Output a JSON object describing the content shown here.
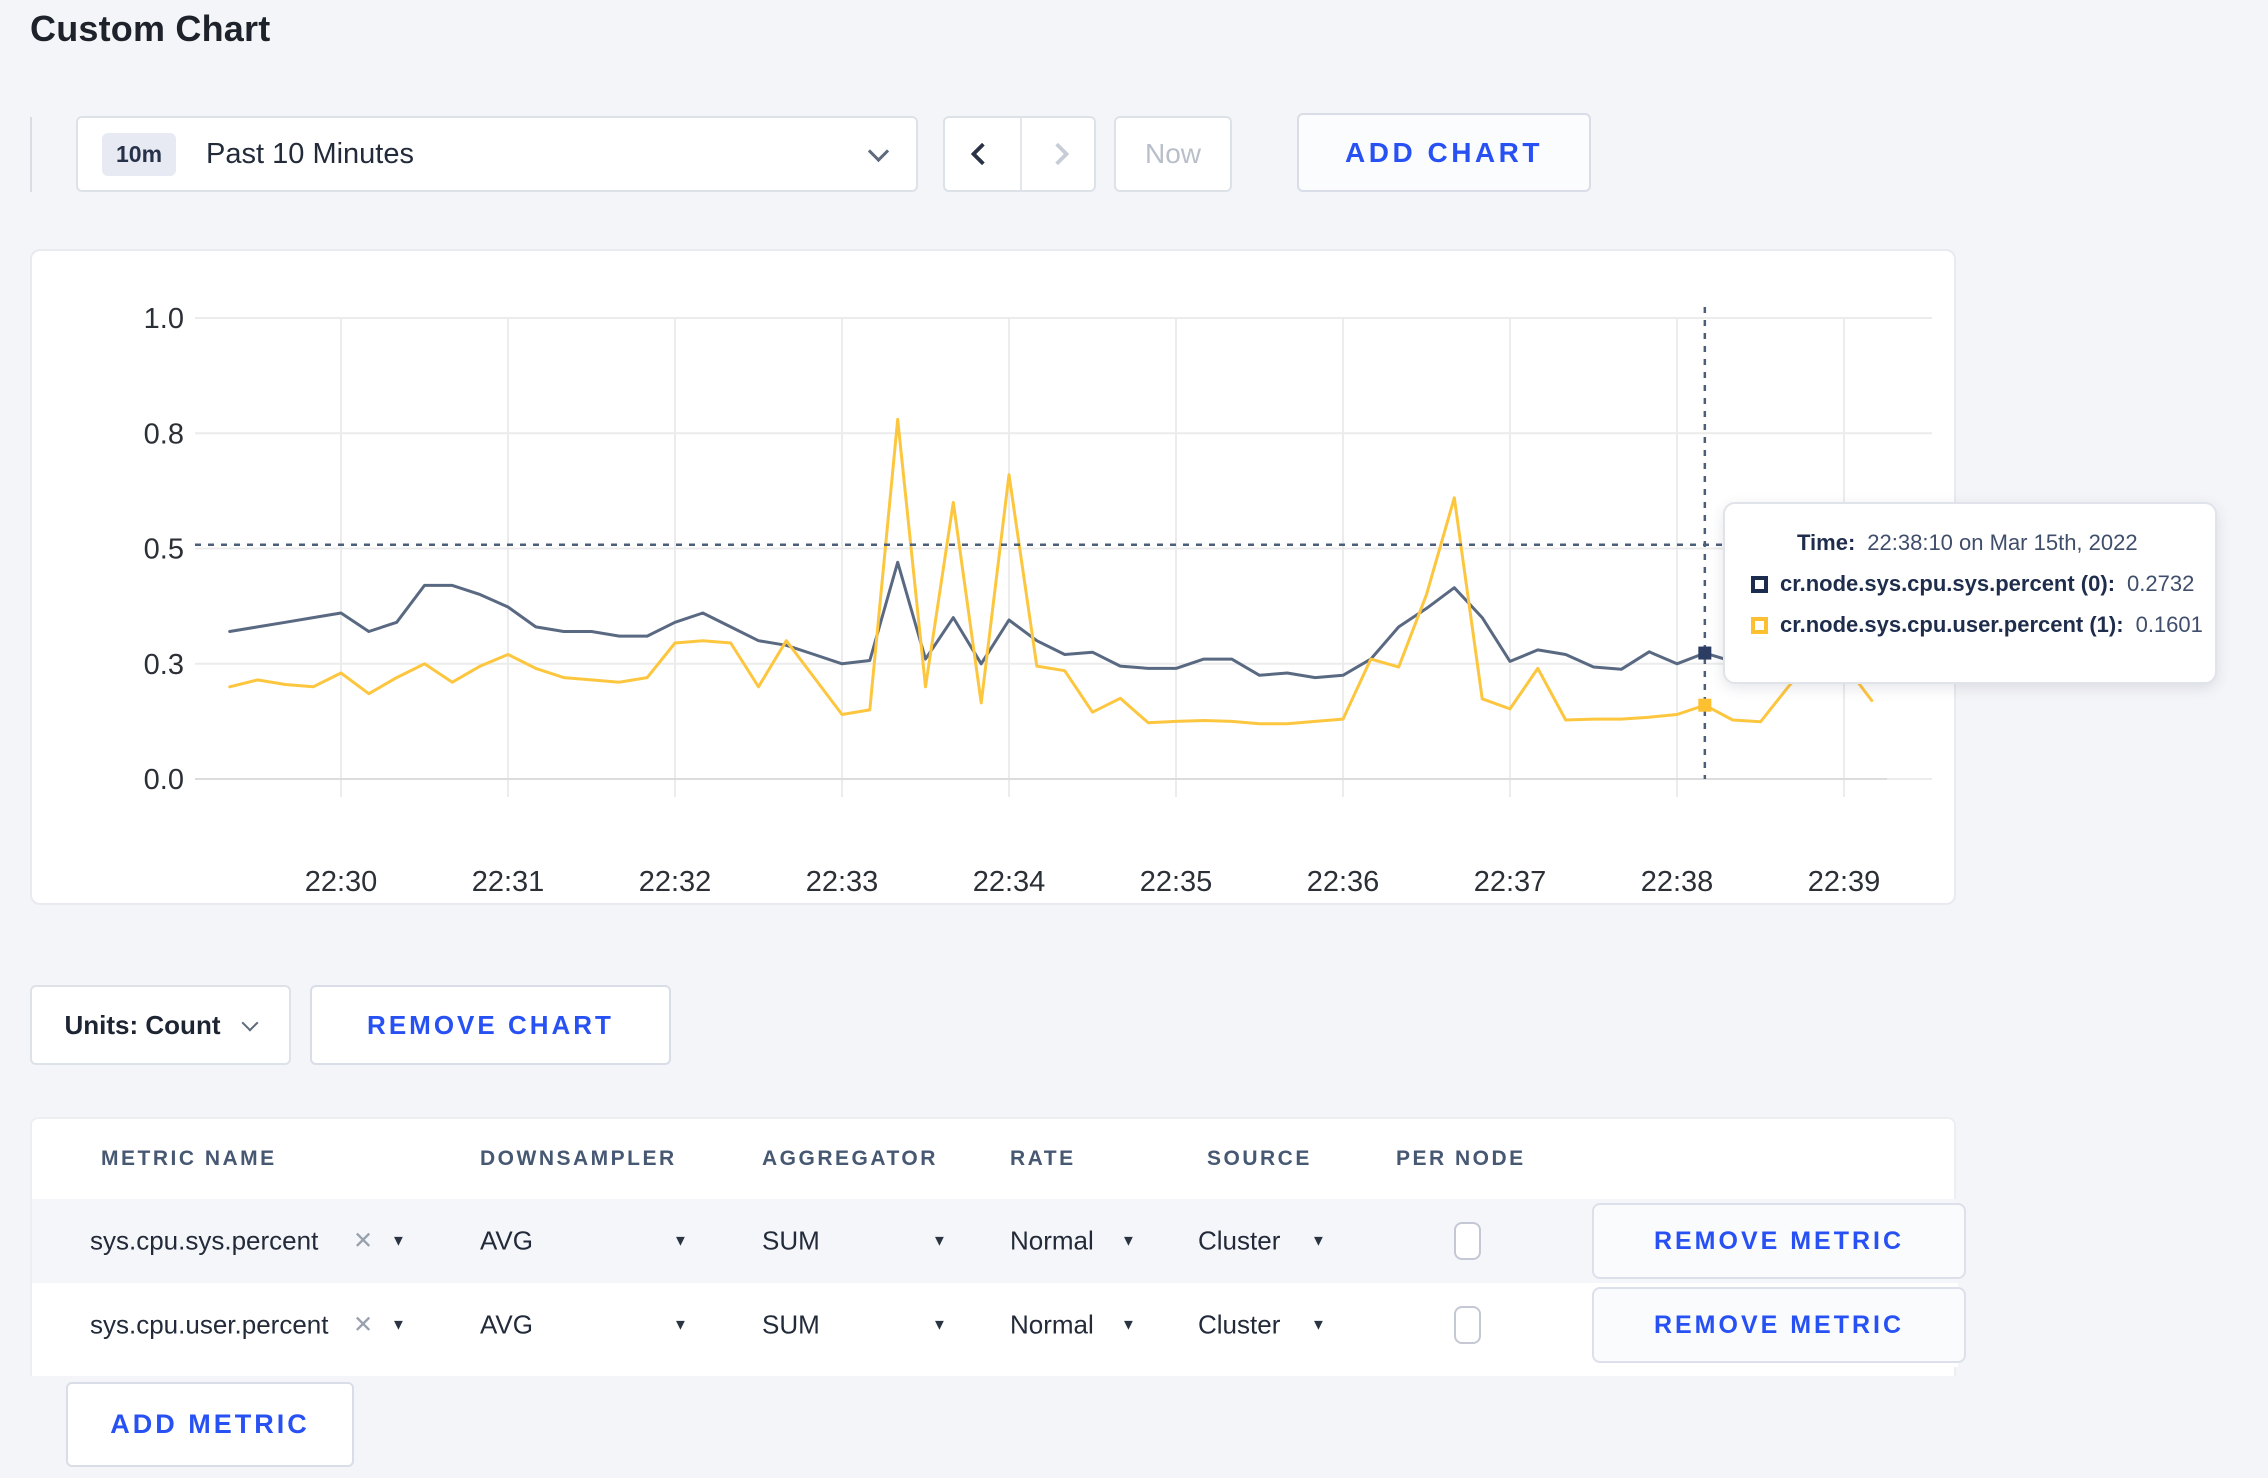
{
  "page": {
    "title": "Custom Chart"
  },
  "toolbar": {
    "time_range": {
      "badge": "10m",
      "label": "Past 10 Minutes"
    },
    "prev_label": "previous range",
    "next_label": "next range",
    "now_label": "Now",
    "add_chart_label": "ADD CHART"
  },
  "chart_data": {
    "type": "line",
    "title": "",
    "xlabel": "",
    "ylabel": "",
    "ylim": [
      0,
      1
    ],
    "grid": true,
    "legend_position": "none",
    "y_ticks": [
      "1.0",
      "0.8",
      "0.5",
      "0.3",
      "0.0"
    ],
    "y_tick_values": [
      1.0,
      0.75,
      0.5,
      0.25,
      0.0
    ],
    "x_ticks": [
      "22:30",
      "22:31",
      "22:32",
      "22:33",
      "22:34",
      "22:35",
      "22:36",
      "22:37",
      "22:38",
      "22:39"
    ],
    "sample_interval_seconds": 10,
    "first_sample_seconds_after_2230": -40,
    "series": [
      {
        "name": "cr.node.sys.cpu.sys.percent",
        "color": "#5a6982",
        "values": [
          0.32,
          0.33,
          0.34,
          0.35,
          0.36,
          0.32,
          0.34,
          0.42,
          0.42,
          0.4,
          0.373,
          0.33,
          0.32,
          0.32,
          0.31,
          0.31,
          0.34,
          0.36,
          0.33,
          0.3,
          0.29,
          0.27,
          0.25,
          0.257,
          0.47,
          0.26,
          0.35,
          0.25,
          0.345,
          0.3,
          0.27,
          0.275,
          0.245,
          0.24,
          0.24,
          0.26,
          0.26,
          0.225,
          0.23,
          0.22,
          0.225,
          0.26,
          0.33,
          0.37,
          0.415,
          0.35,
          0.255,
          0.28,
          0.27,
          0.243,
          0.238,
          0.276,
          0.25,
          0.2732,
          0.255,
          0.27,
          0.3,
          0.31,
          0.3,
          0.3
        ]
      },
      {
        "name": "cr.node.sys.cpu.user.percent",
        "color": "#fdc63f",
        "values": [
          0.2,
          0.215,
          0.205,
          0.2,
          0.23,
          0.185,
          0.22,
          0.25,
          0.21,
          0.245,
          0.27,
          0.24,
          0.22,
          0.215,
          0.21,
          0.22,
          0.295,
          0.3,
          0.295,
          0.2,
          0.3,
          0.22,
          0.14,
          0.15,
          0.78,
          0.2,
          0.6,
          0.165,
          0.66,
          0.245,
          0.235,
          0.145,
          0.175,
          0.122,
          0.125,
          0.127,
          0.125,
          0.12,
          0.12,
          0.125,
          0.13,
          0.26,
          0.243,
          0.4,
          0.61,
          0.174,
          0.152,
          0.24,
          0.128,
          0.13,
          0.13,
          0.134,
          0.14,
          0.1601,
          0.128,
          0.124,
          0.2,
          0.27,
          0.25,
          0.17
        ]
      }
    ],
    "crosshair": {
      "time_seconds_after_2230": 490,
      "horizontal_value": 0.508,
      "point_values": [
        0.2732,
        0.1601
      ]
    }
  },
  "tooltip": {
    "time_label": "Time:",
    "time_value": "22:38:10 on Mar 15th, 2022",
    "rows": [
      {
        "label": "cr.node.sys.cpu.sys.percent (0):",
        "value": "0.2732"
      },
      {
        "label": "cr.node.sys.cpu.user.percent (1):",
        "value": "0.1601"
      }
    ]
  },
  "chart_footer": {
    "units_label": "Units: Count",
    "remove_chart_label": "REMOVE CHART"
  },
  "metrics": {
    "columns": [
      "METRIC NAME",
      "DOWNSAMPLER",
      "AGGREGATOR",
      "RATE",
      "SOURCE",
      "PER NODE"
    ],
    "rows": [
      {
        "metric": "sys.cpu.sys.percent",
        "downsampler": "AVG",
        "aggregator": "SUM",
        "rate": "Normal",
        "source": "Cluster",
        "per_node": false,
        "remove_label": "REMOVE METRIC"
      },
      {
        "metric": "sys.cpu.user.percent",
        "downsampler": "AVG",
        "aggregator": "SUM",
        "rate": "Normal",
        "source": "Cluster",
        "per_node": false,
        "remove_label": "REMOVE METRIC"
      }
    ],
    "add_metric_label": "ADD METRIC"
  },
  "colors": {
    "accent_blue": "#2851f4",
    "series_navy": "#5a6982",
    "series_yellow": "#fdc63f",
    "crosshair": "#4c5f7a"
  }
}
